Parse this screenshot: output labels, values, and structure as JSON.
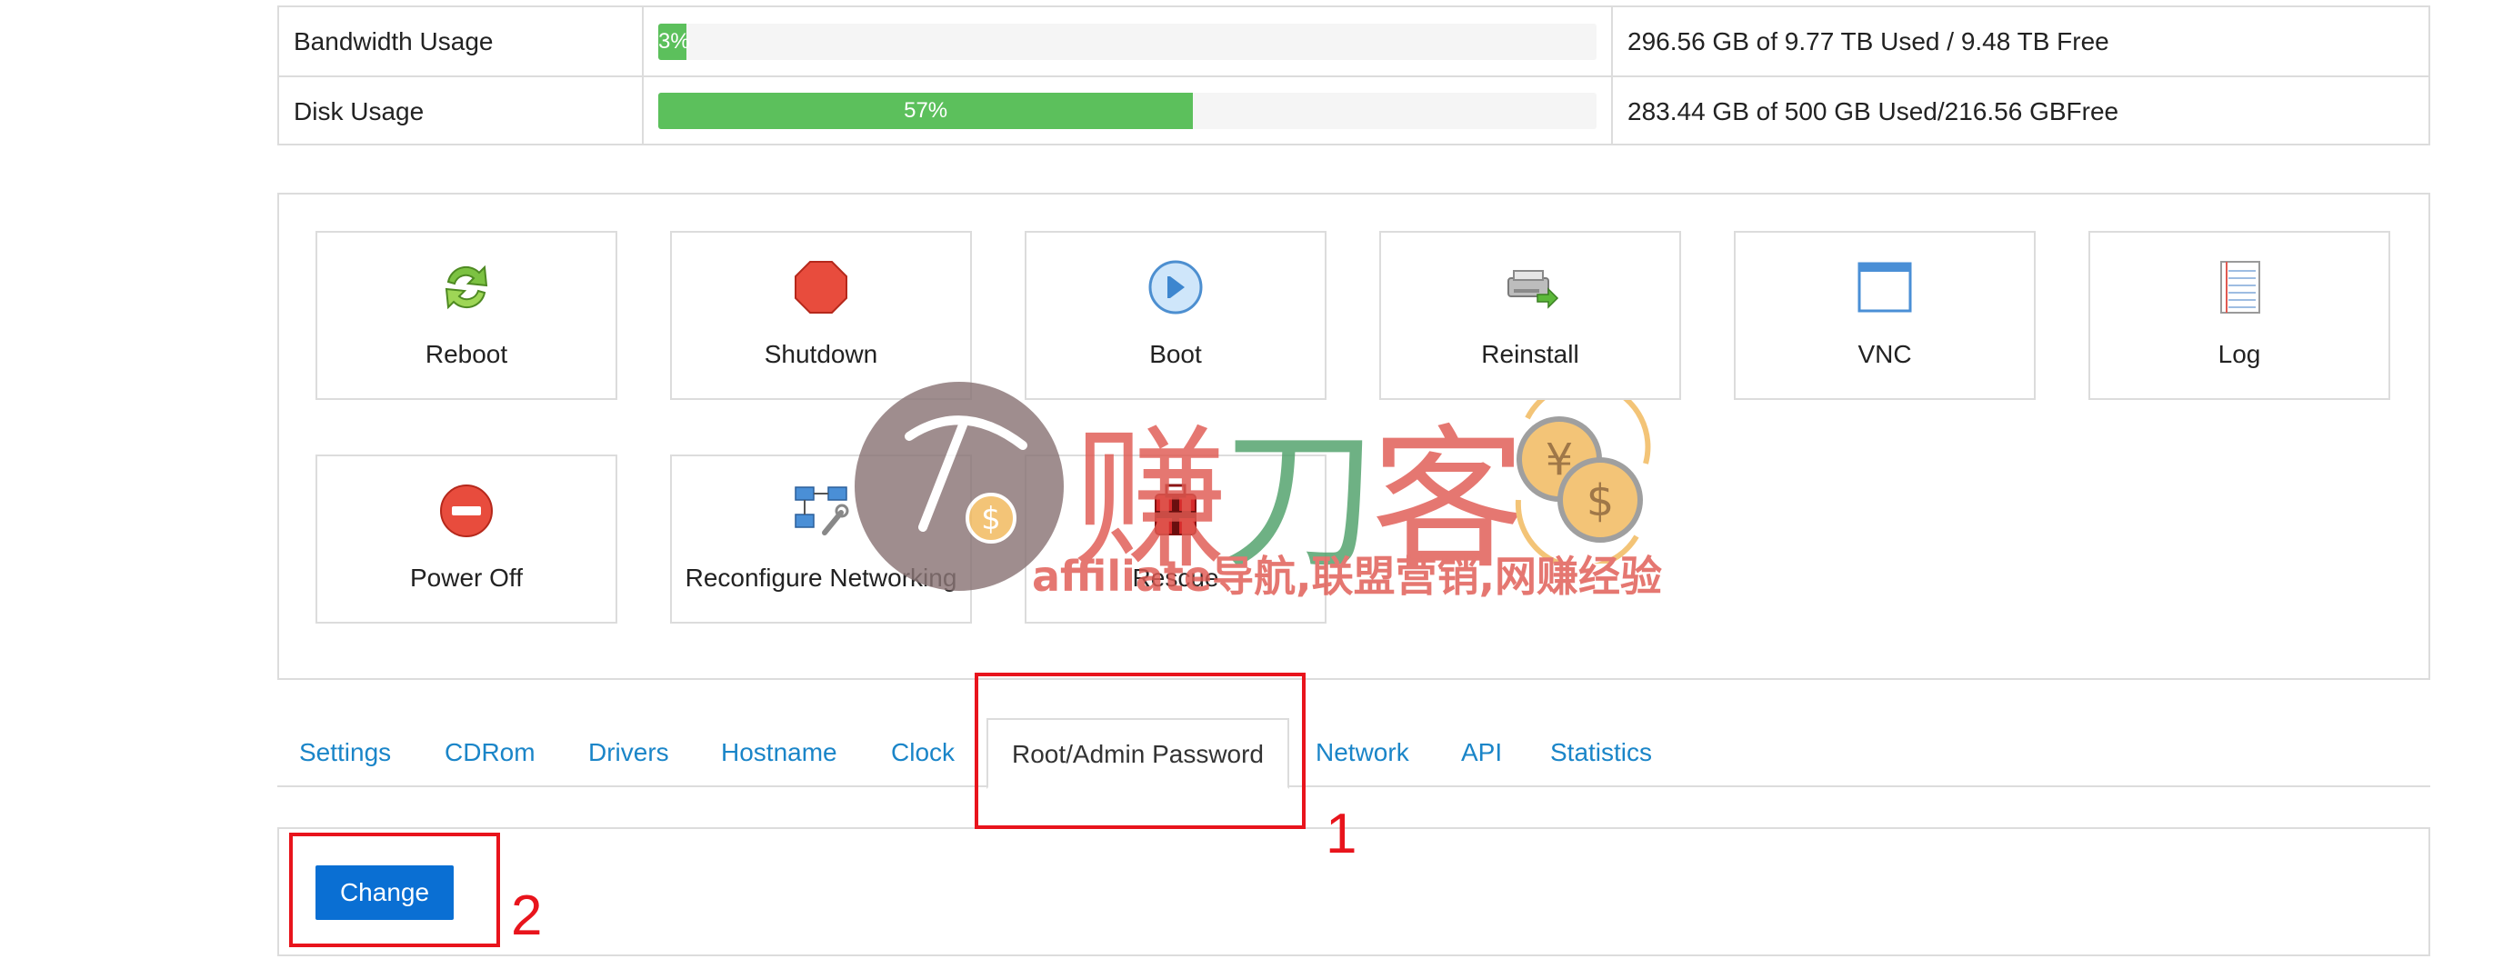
{
  "usage": [
    {
      "label": "Bandwidth Usage",
      "percent": 3,
      "percent_text": "3%",
      "detail": "296.56 GB of 9.77 TB Used / 9.48 TB Free"
    },
    {
      "label": "Disk Usage",
      "percent": 57,
      "percent_text": "57%",
      "detail": "283.44 GB of 500 GB Used/216.56 GBFree"
    }
  ],
  "actions": [
    {
      "label": "Reboot",
      "icon": "reboot-icon"
    },
    {
      "label": "Shutdown",
      "icon": "shutdown-icon"
    },
    {
      "label": "Boot",
      "icon": "boot-icon"
    },
    {
      "label": "Reinstall",
      "icon": "reinstall-icon"
    },
    {
      "label": "VNC",
      "icon": "vnc-icon"
    },
    {
      "label": "Log",
      "icon": "log-icon"
    },
    {
      "label": "Power Off",
      "icon": "power-off-icon"
    },
    {
      "label": "Reconfigure Networking",
      "icon": "network-icon"
    },
    {
      "label": "Rescue",
      "icon": "rescue-icon"
    }
  ],
  "tabs": [
    {
      "label": "Settings"
    },
    {
      "label": "CDRom"
    },
    {
      "label": "Drivers"
    },
    {
      "label": "Hostname"
    },
    {
      "label": "Clock"
    },
    {
      "label": "Root/Admin Password",
      "active": true
    },
    {
      "label": "Network"
    },
    {
      "label": "API"
    },
    {
      "label": "Statistics"
    }
  ],
  "content": {
    "change_label": "Change"
  },
  "annotations": {
    "step1": "1",
    "step2": "2"
  },
  "watermark": {
    "chars": [
      "赚",
      "刀",
      "客"
    ],
    "subtitle": "affiliate导航,联盟营销,网赚经验"
  },
  "colors": {
    "accent": "#0a6fd3",
    "link": "#1a85c8",
    "progress": "#5cc05c",
    "annotation": "#e8141c"
  }
}
